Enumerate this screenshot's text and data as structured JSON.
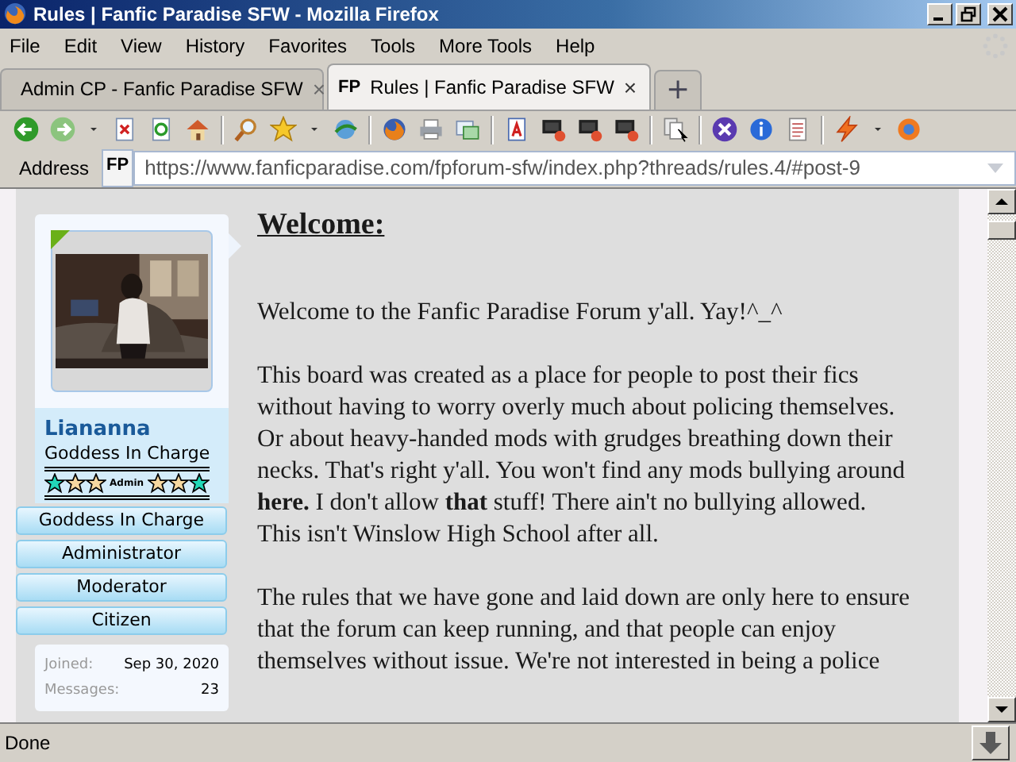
{
  "window": {
    "title": "Rules | Fanfic Paradise SFW - Mozilla Firefox"
  },
  "menu": [
    "File",
    "Edit",
    "View",
    "History",
    "Favorites",
    "Tools",
    "More Tools",
    "Help"
  ],
  "tabs": [
    {
      "kind": "page",
      "label": "Admin CP - Fanfic Paradise SFW",
      "close": "×",
      "selected": false
    },
    {
      "kind": "site",
      "favicon": "FP",
      "label": "Rules | Fanfic Paradise SFW",
      "close": "×",
      "selected": true
    }
  ],
  "new_tab": "+",
  "address": {
    "label": "Address",
    "favicon": "FP",
    "value": "https://www.fanficparadise.com/fpforum-sfw/index.php?threads/rules.4/#post-9"
  },
  "post": {
    "author": {
      "name": "Liananna",
      "title": "Goddess In Charge",
      "rank_label": "Admin",
      "groups": [
        "Goddess In Charge",
        "Administrator",
        "Moderator",
        "Citizen"
      ],
      "stats": [
        {
          "label": "Joined:",
          "value": "Sep 30, 2020"
        },
        {
          "label": "Messages:",
          "value": "23"
        }
      ]
    },
    "heading": "Welcome:",
    "paragraphs": [
      "Welcome to the Fanfic Paradise Forum y'all. Yay!^_^",
      "This board was created as a place for people to post their fics\nwithout having to worry overly much about policing themselves.\nOr about heavy-handed mods with grudges breathing down their\nnecks. That's right y'all. You won't find any mods bullying around\n**here.** I don't allow **that** stuff! There ain't no bullying allowed.\nThis isn't Winslow High School after all.",
      "The rules that we have gone and laid down are only here to ensure\nthat the forum can keep running, and that people can enjoy\nthemselves without issue. We're not interested in being a police"
    ]
  },
  "status_bar": {
    "text": "Done"
  }
}
